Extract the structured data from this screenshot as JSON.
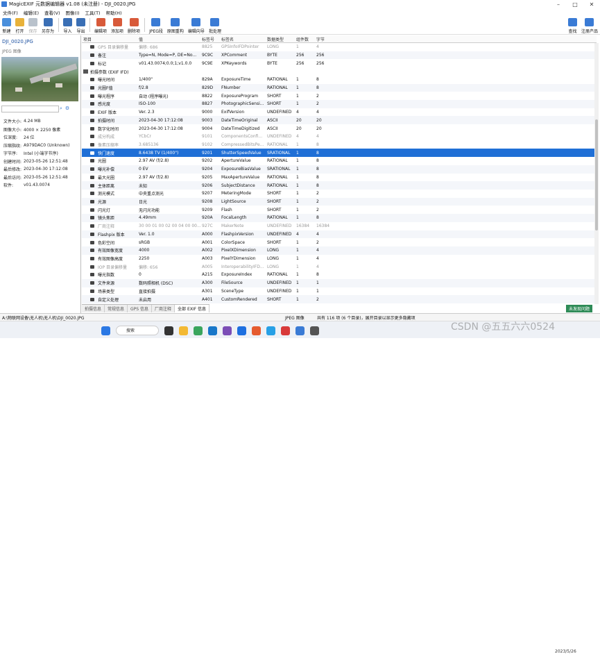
{
  "window": {
    "title": "MagicEXIF 元数据编辑器 v1.08 (未注册) - DJI_0020.JPG"
  },
  "menu": [
    "文件(F)",
    "编辑(E)",
    "查看(V)",
    "图像(I)",
    "工具(T)",
    "帮助(H)"
  ],
  "toolbar": {
    "items": [
      {
        "label": "新建",
        "icon": "new-file-icon",
        "color": "#4a8fdc",
        "enabled": true
      },
      {
        "label": "打开",
        "icon": "folder-open-icon",
        "color": "#e8b23a",
        "enabled": true
      },
      {
        "label": "保存",
        "icon": "save-icon",
        "color": "#b9c2cc",
        "enabled": false
      },
      {
        "label": "另存为",
        "icon": "save-as-icon",
        "color": "#3a6fb5",
        "enabled": true
      },
      {
        "label": "导入",
        "icon": "import-icon",
        "color": "#3a6fb5",
        "enabled": true
      },
      {
        "label": "导出",
        "icon": "export-icon",
        "color": "#3a6fb5",
        "enabled": true
      },
      {
        "label": "编辑项",
        "icon": "edit-item-icon",
        "color": "#d85a3a",
        "enabled": true
      },
      {
        "label": "添加项",
        "icon": "add-item-icon",
        "color": "#d85a3a",
        "enabled": true
      },
      {
        "label": "删除项",
        "icon": "delete-item-icon",
        "color": "#d85a3a",
        "enabled": true
      },
      {
        "label": "JPEG段",
        "icon": "jpeg-segment-icon",
        "color": "#3a7bd5",
        "enabled": true
      },
      {
        "label": "原图重构",
        "icon": "rebuild-icon",
        "color": "#3a7bd5",
        "enabled": true
      },
      {
        "label": "编辑向导",
        "icon": "wizard-icon",
        "color": "#3a7bd5",
        "enabled": true
      },
      {
        "label": "批处理",
        "icon": "batch-icon",
        "color": "#3a7bd5",
        "enabled": true
      }
    ],
    "right": [
      {
        "label": "查找",
        "icon": "find-icon"
      },
      {
        "label": "注册产品",
        "icon": "register-icon"
      }
    ]
  },
  "left": {
    "filename": "DJI_0020.JPG",
    "filetype": "JPEG 图像",
    "search_placeholder": "",
    "props": [
      {
        "k": "文件大小:",
        "v": "4.24 MB"
      },
      {
        "k": "图像大小:",
        "v": "4000 × 2250 像素"
      },
      {
        "k": "位深度:",
        "v": "24 位"
      },
      {
        "k": "压缩指纹:",
        "v": "A979DAC0 (Unknown)"
      },
      {
        "k": "字节序:",
        "v": "Intel (小端字节序)"
      },
      {
        "k": "创建时间:",
        "v": "2023-05-26 12:51:48"
      },
      {
        "k": "最后修改:",
        "v": "2023-04-30 17:12:08"
      },
      {
        "k": "最后访问:",
        "v": "2023-05-26 12:51:48"
      },
      {
        "k": "软件:",
        "v": "v01.43.0074"
      }
    ]
  },
  "table": {
    "headers": [
      "项目",
      "值",
      "标签号",
      "标签名",
      "数据类型",
      "组件数",
      "字节"
    ],
    "rows": [
      {
        "k": "GPS 目录偏移量",
        "v": "偏移: 686",
        "id": "8825",
        "name": "GPSInfoIFDPointer",
        "type": "LONG",
        "n": "1",
        "b": "4",
        "style": "dim"
      },
      {
        "k": "备注",
        "v": "Type=N, Mode=P, DE=No...",
        "id": "9C9C",
        "name": "XPComment",
        "type": "BYTE",
        "n": "256",
        "b": "256",
        "style": ""
      },
      {
        "k": "标记",
        "v": "v01.43.0074;0.0;1;v1.0.0",
        "id": "9C9E",
        "name": "XPKeywords",
        "type": "BYTE",
        "n": "256",
        "b": "256",
        "style": ""
      },
      {
        "k": "拍摄参数 (EXIF IFD)",
        "v": "",
        "id": "",
        "name": "",
        "type": "",
        "n": "",
        "b": "",
        "style": "group"
      },
      {
        "k": "曝光时间",
        "v": "1/400\"",
        "id": "829A",
        "name": "ExposureTime",
        "type": "RATIONAL",
        "n": "1",
        "b": "8",
        "style": ""
      },
      {
        "k": "光圈F值",
        "v": "f/2.8",
        "id": "829D",
        "name": "FNumber",
        "type": "RATIONAL",
        "n": "1",
        "b": "8",
        "style": ""
      },
      {
        "k": "曝光程序",
        "v": "自动 (程序曝光)",
        "id": "8822",
        "name": "ExposureProgram",
        "type": "SHORT",
        "n": "1",
        "b": "2",
        "style": ""
      },
      {
        "k": "感光度",
        "v": "ISO-100",
        "id": "8827",
        "name": "PhotographicSensi...",
        "type": "SHORT",
        "n": "1",
        "b": "2",
        "style": ""
      },
      {
        "k": "EXIF 版本",
        "v": "Ver. 2.3",
        "id": "9000",
        "name": "ExifVersion",
        "type": "UNDEFINED",
        "n": "4",
        "b": "4",
        "style": ""
      },
      {
        "k": "拍摄时间",
        "v": "2023-04-30 17:12:08",
        "id": "9003",
        "name": "DateTimeOriginal",
        "type": "ASCII",
        "n": "20",
        "b": "20",
        "style": ""
      },
      {
        "k": "数字化时间",
        "v": "2023-04-30 17:12:08",
        "id": "9004",
        "name": "DateTimeDigitized",
        "type": "ASCII",
        "n": "20",
        "b": "20",
        "style": ""
      },
      {
        "k": "成分构成",
        "v": "YCbCr",
        "id": "9101",
        "name": "ComponentsConfi...",
        "type": "UNDEFINED",
        "n": "4",
        "b": "4",
        "style": "dim"
      },
      {
        "k": "像素压缩率",
        "v": "3.685136",
        "id": "9102",
        "name": "CompressedBitsPe...",
        "type": "RATIONAL",
        "n": "1",
        "b": "8",
        "style": "dim"
      },
      {
        "k": "快门速度",
        "v": "8.6438 TV (1/400\")",
        "id": "9201",
        "name": "ShutterSpeedValue",
        "type": "SRATIONAL",
        "n": "1",
        "b": "8",
        "style": "sel"
      },
      {
        "k": "光圈",
        "v": "2.97 AV (f/2.8)",
        "id": "9202",
        "name": "ApertureValue",
        "type": "RATIONAL",
        "n": "1",
        "b": "8",
        "style": ""
      },
      {
        "k": "曝光补偿",
        "v": "0 EV",
        "id": "9204",
        "name": "ExposureBiasValue",
        "type": "SRATIONAL",
        "n": "1",
        "b": "8",
        "style": ""
      },
      {
        "k": "最大光圈",
        "v": "2.97 AV (f/2.8)",
        "id": "9205",
        "name": "MaxApertureValue",
        "type": "RATIONAL",
        "n": "1",
        "b": "8",
        "style": ""
      },
      {
        "k": "主体距离",
        "v": "未知",
        "id": "9206",
        "name": "SubjectDistance",
        "type": "RATIONAL",
        "n": "1",
        "b": "8",
        "style": ""
      },
      {
        "k": "测光模式",
        "v": "中央重点测光",
        "id": "9207",
        "name": "MeteringMode",
        "type": "SHORT",
        "n": "1",
        "b": "2",
        "style": ""
      },
      {
        "k": "光源",
        "v": "日光",
        "id": "9208",
        "name": "LightSource",
        "type": "SHORT",
        "n": "1",
        "b": "2",
        "style": ""
      },
      {
        "k": "闪光灯",
        "v": "无闪光功能",
        "id": "9209",
        "name": "Flash",
        "type": "SHORT",
        "n": "1",
        "b": "2",
        "style": ""
      },
      {
        "k": "镜头焦距",
        "v": "4.49mm",
        "id": "920A",
        "name": "FocalLength",
        "type": "RATIONAL",
        "n": "1",
        "b": "8",
        "style": ""
      },
      {
        "k": "厂商注释",
        "v": "30 00 01 00 02 00 04 00 00...",
        "id": "927C",
        "name": "MakerNote",
        "type": "UNDEFINED",
        "n": "16384",
        "b": "16384",
        "style": "dim"
      },
      {
        "k": "Flashpix 版本",
        "v": "Ver. 1.0",
        "id": "A000",
        "name": "FlashpixVersion",
        "type": "UNDEFINED",
        "n": "4",
        "b": "4",
        "style": ""
      },
      {
        "k": "色彩空间",
        "v": "sRGB",
        "id": "A001",
        "name": "ColorSpace",
        "type": "SHORT",
        "n": "1",
        "b": "2",
        "style": ""
      },
      {
        "k": "有效图像宽度",
        "v": "4000",
        "id": "A002",
        "name": "PixelXDimension",
        "type": "LONG",
        "n": "1",
        "b": "4",
        "style": ""
      },
      {
        "k": "有效图像高度",
        "v": "2250",
        "id": "A003",
        "name": "PixelYDimension",
        "type": "LONG",
        "n": "1",
        "b": "4",
        "style": ""
      },
      {
        "k": "IOP 目录偏移量",
        "v": "偏移: 656",
        "id": "A005",
        "name": "InteroperabilityIFD...",
        "type": "LONG",
        "n": "1",
        "b": "4",
        "style": "dim"
      },
      {
        "k": "曝光指数",
        "v": "0",
        "id": "A215",
        "name": "ExposureIndex",
        "type": "RATIONAL",
        "n": "1",
        "b": "8",
        "style": ""
      },
      {
        "k": "文件来源",
        "v": "数码照相机 (DSC)",
        "id": "A300",
        "name": "FileSource",
        "type": "UNDEFINED",
        "n": "1",
        "b": "1",
        "style": ""
      },
      {
        "k": "场景类型",
        "v": "直接拍摄",
        "id": "A301",
        "name": "SceneType",
        "type": "UNDEFINED",
        "n": "1",
        "b": "1",
        "style": ""
      },
      {
        "k": "自定义处理",
        "v": "未启用",
        "id": "A401",
        "name": "CustomRendered",
        "type": "SHORT",
        "n": "1",
        "b": "2",
        "style": ""
      }
    ]
  },
  "tabs": [
    {
      "label": "拍摄信息",
      "active": false
    },
    {
      "label": "常规信息",
      "active": false
    },
    {
      "label": "GPS 信息",
      "active": false
    },
    {
      "label": "厂商注释",
      "active": false
    },
    {
      "label": "全部 EXIF 信息",
      "active": true
    }
  ],
  "update_badge": "未发现问题",
  "status": {
    "path": "A:\\物联网设备\\无人机\\无人机\\DJI_0020.JPG",
    "type": "JPEG 图像",
    "count": "共有 116 项 (6 个目录)，展开目录以显示更多隐藏项"
  },
  "taskbar": {
    "search": "搜索",
    "date": "2023/5/26"
  },
  "watermark": "CSDN @五五六六0524"
}
